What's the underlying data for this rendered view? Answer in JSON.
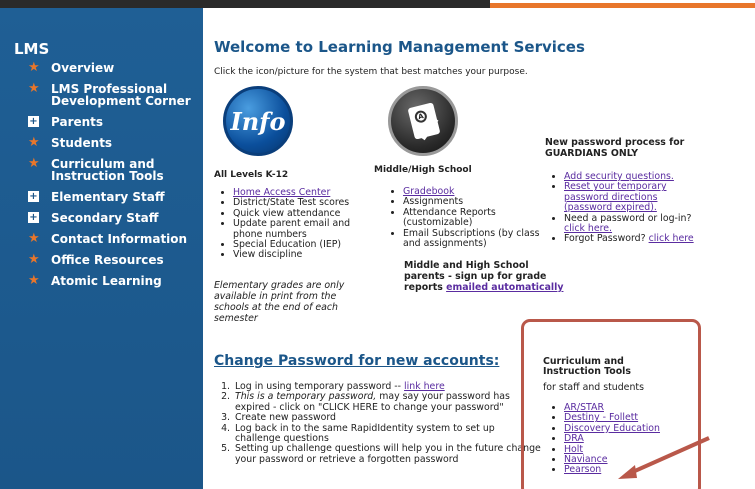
{
  "sidebar": {
    "heading": "LMS",
    "items": [
      {
        "label": "Overview",
        "bullet": "star"
      },
      {
        "label": "LMS Professional Development Corner",
        "bullet": "star"
      },
      {
        "label": "Parents",
        "bullet": "plus"
      },
      {
        "label": "Students",
        "bullet": "star"
      },
      {
        "label": "Curriculum and Instruction Tools",
        "bullet": "star"
      },
      {
        "label": "Elementary Staff",
        "bullet": "plus"
      },
      {
        "label": "Secondary Staff",
        "bullet": "plus"
      },
      {
        "label": "Contact Information",
        "bullet": "star"
      },
      {
        "label": "Office Resources",
        "bullet": "star"
      },
      {
        "label": "Atomic Learning",
        "bullet": "star"
      }
    ]
  },
  "main": {
    "title": "Welcome to Learning Management Services",
    "subtitle": "Click the icon/picture for the system that best matches your purpose.",
    "info_icon_text": "Info",
    "col1": {
      "heading": "All Levels K-12",
      "items": [
        {
          "text": "Home Access Center",
          "link": true
        },
        {
          "text": "District/State Test scores",
          "link": false
        },
        {
          "text": "Quick view attendance",
          "link": false
        },
        {
          "text": "Update parent email and phone numbers",
          "link": false
        },
        {
          "text": "Special Education (IEP)",
          "link": false
        },
        {
          "text": "View discipline",
          "link": false
        }
      ],
      "note": "Elementary grades are only available in print from the schools at the end of each semester"
    },
    "col2": {
      "heading": "Middle/High School",
      "items": [
        {
          "text": "Gradebook",
          "link": true
        },
        {
          "text": "Assignments",
          "link": false
        },
        {
          "text": "Attendance Reports (customizable)",
          "link": false
        },
        {
          "text": "Email Subscriptions (by class and assignments)",
          "link": false
        }
      ],
      "note_text": "Middle and High School parents - sign up for grade reports ",
      "note_link": "emailed automatically"
    },
    "col3": {
      "heading": "New password process for GUARDIANS ONLY",
      "items": [
        {
          "text": "Add security questions.",
          "link_text": "Add security questions.",
          "prefix": ""
        },
        {
          "text": "Reset your temporary password directions (password expired).",
          "link_text": "Reset your temporary password directions (password expired).",
          "prefix": ""
        },
        {
          "prefix": "Need a password or log-in? ",
          "link_text": "click here."
        },
        {
          "prefix": "Forgot Password? ",
          "link_text": "click here"
        }
      ]
    },
    "change_password": {
      "title": "Change Password for new accounts:",
      "steps": [
        {
          "prefix": "Log in using temporary password -- ",
          "link": "link here",
          "italic": ""
        },
        {
          "prefix": "",
          "link": "",
          "italic": "This is a temporary password,",
          "suffix": " may say your password has expired - click on \"CLICK HERE to change your password\""
        },
        {
          "prefix": "Create new password",
          "link": "",
          "italic": ""
        },
        {
          "prefix": "Log back in to the same RapidIdentity system to set up challenge questions",
          "link": "",
          "italic": ""
        },
        {
          "prefix": "Setting up challenge questions will help you in the future change your password or retrieve a forgotten password",
          "link": "",
          "italic": ""
        }
      ]
    },
    "tools": {
      "heading": "Curriculum and Instruction Tools",
      "sub": "for staff and students",
      "items": [
        "AR/STAR",
        "Destiny - Follett",
        "Discovery Education",
        "DRA",
        "Holt",
        "Naviance",
        "Pearson"
      ]
    }
  },
  "colors": {
    "sidebar": "#1b5689",
    "accent": "#e8762b",
    "link": "#5a2ca0",
    "highlight_box": "#b9584a"
  }
}
